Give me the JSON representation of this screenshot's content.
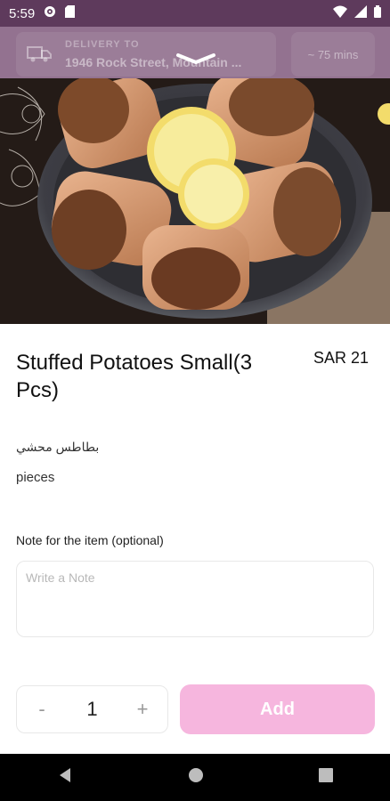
{
  "status_bar": {
    "time": "5:59"
  },
  "header": {
    "delivery_label": "DELIVERY TO",
    "delivery_address": "1946 Rock Street, Mountain ...",
    "eta": "~ 75 mins"
  },
  "item": {
    "name": "Stuffed Potatoes Small(3 Pcs)",
    "price": "SAR 21",
    "arabic_name": "بطاطس محشي",
    "description": "pieces"
  },
  "note": {
    "label": "Note for the item (optional)",
    "placeholder": "Write a Note"
  },
  "quantity": {
    "minus": "-",
    "value": "1",
    "plus": "+"
  },
  "add_button_label": "Add",
  "colors": {
    "status_bar": "#5e3a5c",
    "header": "#8d6a8a",
    "add_button": "#f6b6de"
  }
}
